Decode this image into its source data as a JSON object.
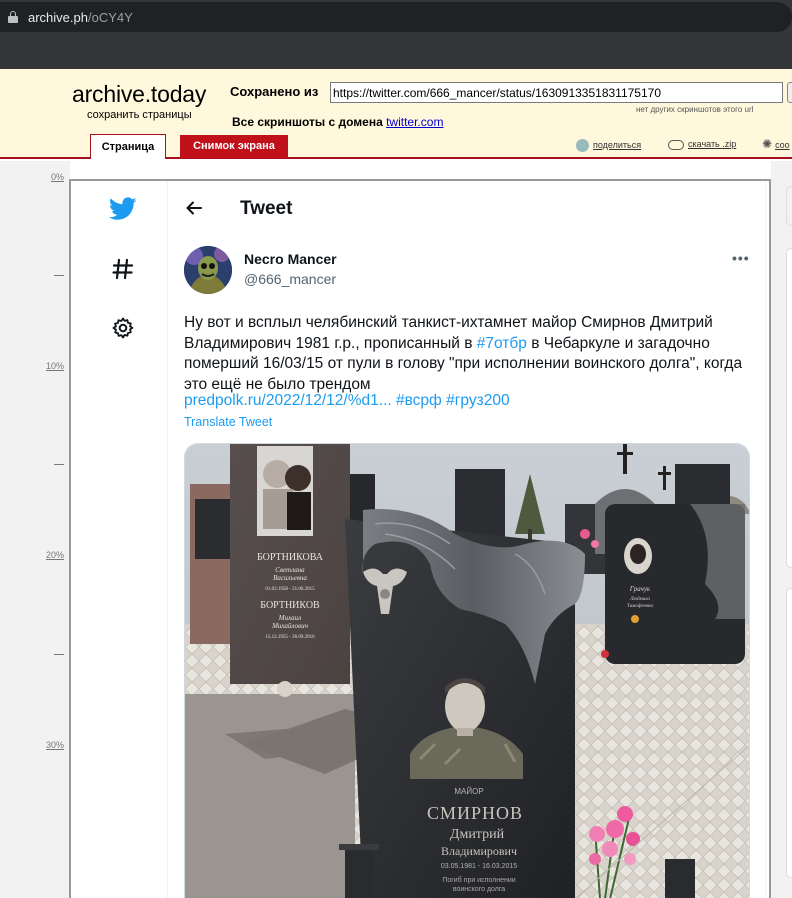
{
  "browser": {
    "url_host": "archive.ph",
    "url_path": "/oCY4Y"
  },
  "archive": {
    "brand": "archive.today",
    "brand_sub": "сохранить страницы",
    "saved_from_label": "Сохранено из",
    "saved_url": "https://twitter.com/666_mancer/status/1630913351831175170",
    "no_other_note": "нет других скриншотов этого url",
    "all_screens_label": "Все скриншоты  с домена",
    "domain_link": "twitter.com",
    "tab_page": "Страница",
    "tab_screenshot": "Снимок экрана",
    "share": "поделиться",
    "download": "скачать .zip",
    "more": "соо",
    "accent_color": "#a4111d"
  },
  "ruler": {
    "labels": [
      "0%",
      "10%",
      "20%",
      "30%"
    ]
  },
  "twitter": {
    "header_title": "Tweet",
    "nav_icons": [
      "twitter-bird-icon",
      "hashtag-icon",
      "settings-gear-icon"
    ],
    "author": {
      "display_name": "Necro Mancer",
      "handle": "@666_mancer"
    },
    "text_part1": "Ну вот и всплыл челябинский танкист-ихтамнет майор Смирнов Дмитрий Владимирович 1981 г.р., прописанный в ",
    "hashtag_7otbr": "#7отбр",
    "text_part2": " в Чебаркуле и загадочно померший 16/03/15 от пули в голову \"при исполнении воинского долга\", когда это ещё не было трендом",
    "link": "predpolk.ru/2022/12/12/%d1...",
    "hashtag_vsrf": "#всрф",
    "hashtag_gruz": "#груз200",
    "translate": "Translate Tweet",
    "accent_color": "#1d9bf0",
    "photo": {
      "left_stone_name": "БОРТНИКОВА",
      "left_stone_given": "Светлана",
      "left_stone_patronymic": "Васильевна",
      "left_stone_dates": "01.03.1958 - 21.06.2015",
      "left_stone_name2": "БОРТНИКОВ",
      "left_stone_given2": "Михаил",
      "left_stone_patronymic2": "Михайлович",
      "left_stone_dates2": "15.12.1955 - 26.09.2016",
      "rank": "МАЙОР",
      "surname": "СМИРНОВ",
      "given": "Дмитрий",
      "patronymic": "Владимирович",
      "dates": "03.05.1981 - 16.03.2015",
      "epitaph_line1": "Погиб при исполнении",
      "epitaph_line2": "воинского долга",
      "back_stone_name": "Грачук",
      "back_stone_given": "Людмила",
      "back_stone_patronymic": "Тимофеевна"
    }
  }
}
